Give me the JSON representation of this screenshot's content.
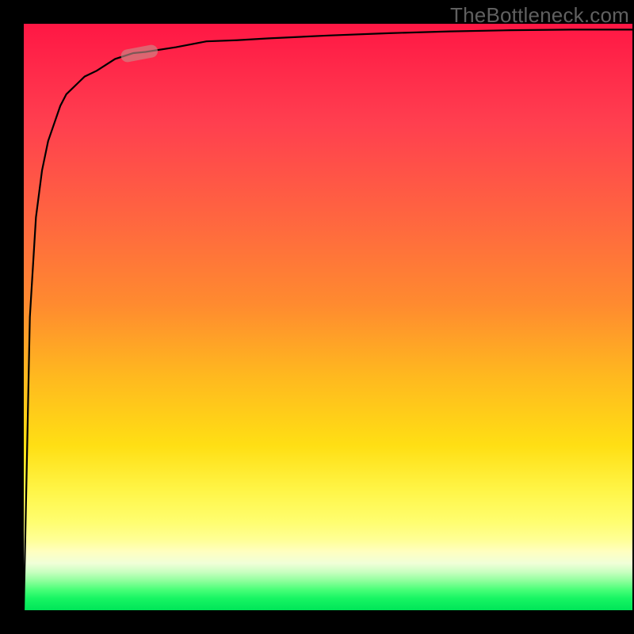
{
  "attribution": {
    "text": "TheBottleneck.com"
  },
  "colors": {
    "curve_stroke": "#000000",
    "highlight_fill": "#c88e8a",
    "highlight_fill_opacity": 0.62
  },
  "chart_data": {
    "type": "line",
    "title": "",
    "xlabel": "",
    "ylabel": "",
    "x_range": [
      0,
      100
    ],
    "y_range": [
      0,
      100
    ],
    "grid": false,
    "legend": false,
    "note": "Curve shape resembles y = 100 - 100/(x+1); a small pill-shaped highlight sits on the curve near x≈18.",
    "series": [
      {
        "name": "curve",
        "x": [
          0,
          1,
          2,
          3,
          4,
          5,
          6,
          7,
          8,
          9,
          10,
          12,
          15,
          18,
          20,
          25,
          30,
          35,
          40,
          50,
          60,
          70,
          80,
          90,
          100
        ],
        "values": [
          0,
          50,
          67,
          75,
          80,
          83,
          86,
          88,
          89,
          90,
          91,
          92,
          94,
          95,
          95.2,
          96,
          97,
          97.2,
          97.5,
          98,
          98.4,
          98.7,
          98.9,
          99,
          99
        ]
      }
    ],
    "highlight_segment": {
      "x_start": 16,
      "x_end": 22
    }
  }
}
